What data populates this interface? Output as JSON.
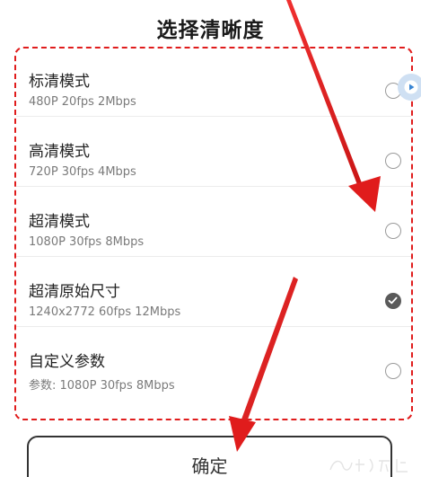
{
  "dialog": {
    "title": "选择清晰度",
    "confirm_label": "确定"
  },
  "options": [
    {
      "name": "标清模式",
      "detail": "480P  20fps  2Mbps",
      "selected": false
    },
    {
      "name": "高清模式",
      "detail": "720P  30fps  4Mbps",
      "selected": false
    },
    {
      "name": "超清模式",
      "detail": "1080P  30fps  8Mbps",
      "selected": false
    },
    {
      "name": "超清原始尺寸",
      "detail": "1240x2772  60fps  12Mbps",
      "selected": true
    },
    {
      "name": "自定义参数",
      "detail": "参数: 1080P 30fps 8Mbps",
      "selected": false
    }
  ],
  "colors": {
    "annotation": "#e01c1c",
    "radio_checked": "#5a5a5a",
    "radio_unchecked": "#9a9a9a"
  },
  "icons": {
    "selected": "check-icon",
    "side_button": "play-icon"
  }
}
